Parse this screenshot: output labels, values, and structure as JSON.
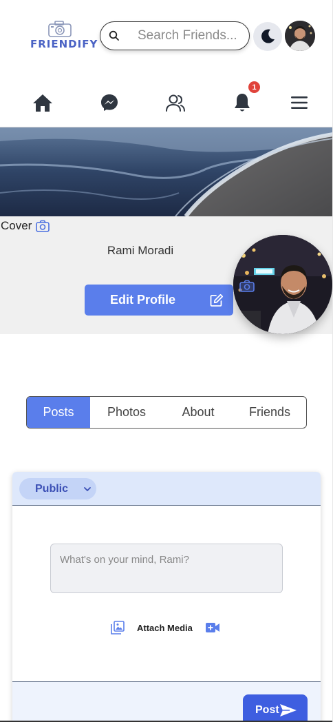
{
  "app": {
    "logo_text": "FRIENDIFY"
  },
  "search": {
    "placeholder": "Search Friends..."
  },
  "nav": {
    "items": [
      {
        "name": "home",
        "icon": "home-icon"
      },
      {
        "name": "messenger",
        "icon": "messenger-icon"
      },
      {
        "name": "friends",
        "icon": "friends-icon"
      },
      {
        "name": "notifications",
        "icon": "bell-icon"
      },
      {
        "name": "menu",
        "icon": "hamburger-menu-icon"
      }
    ],
    "notification_count": "1"
  },
  "profile": {
    "cover_label": "Cover",
    "name": "Rami Moradi",
    "edit_label": "Edit Profile"
  },
  "tabs": [
    {
      "label": "Posts",
      "active": true
    },
    {
      "label": "Photos",
      "active": false
    },
    {
      "label": "About",
      "active": false
    },
    {
      "label": "Friends",
      "active": false
    }
  ],
  "composer": {
    "privacy": "Public",
    "placeholder": "What's on your mind, Rami?",
    "attach_label": "Attach Media",
    "post_label": "Post"
  },
  "colors": {
    "accent": "#5a7eeb",
    "post_button": "#3e5ee0",
    "badge": "#e0433b",
    "logo": "#4a62c4"
  }
}
